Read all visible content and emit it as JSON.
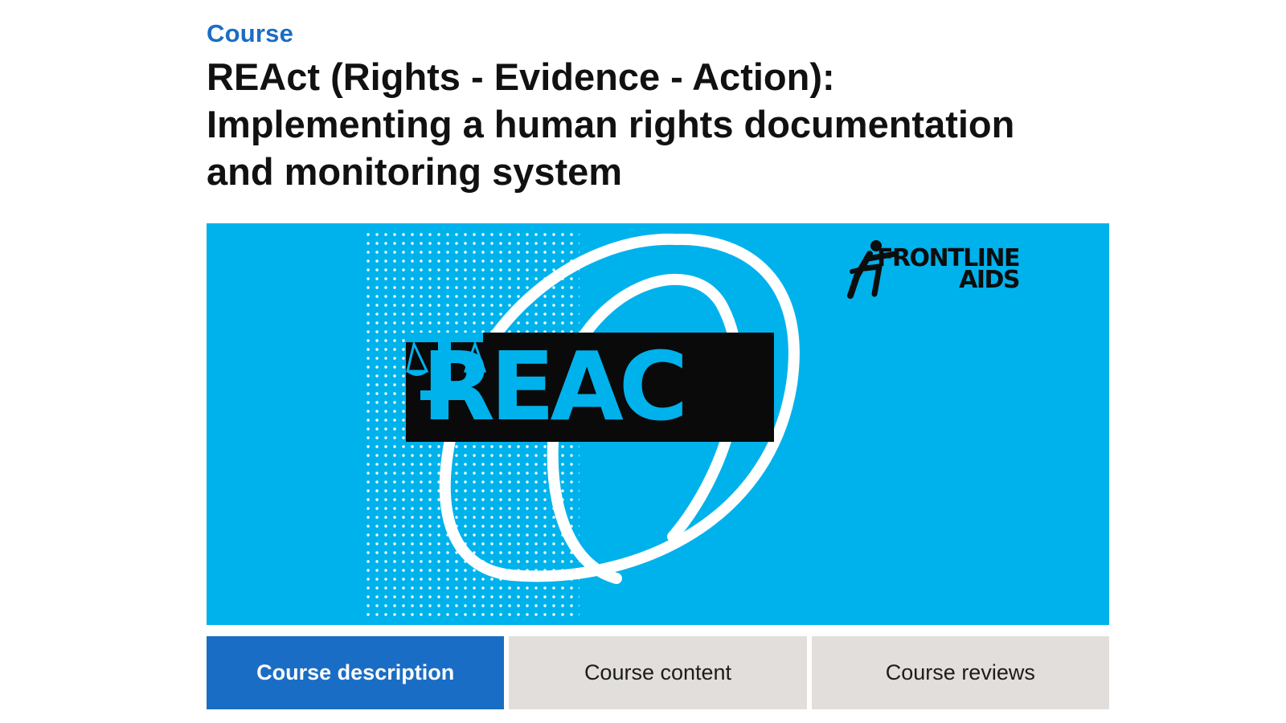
{
  "theme": {
    "accent": "#1a6dc4",
    "hero_bg": "#00b2ec",
    "tab_bg": "#e1dedb"
  },
  "header": {
    "eyebrow": "Course",
    "title_lines": [
      "REAct (Rights - Evidence - Action):",
      "Implementing a human rights documentation",
      "and monitoring system"
    ]
  },
  "hero": {
    "logo_line1": "FRONTLINE",
    "logo_line2": "AIDS",
    "logo_icon": "runner-figure-icon",
    "wordmark": "REAC",
    "wordmark_icon": "scales-of-justice-icon"
  },
  "tabs": [
    {
      "label": "Course description",
      "active": true
    },
    {
      "label": "Course content",
      "active": false
    },
    {
      "label": "Course reviews",
      "active": false
    }
  ]
}
